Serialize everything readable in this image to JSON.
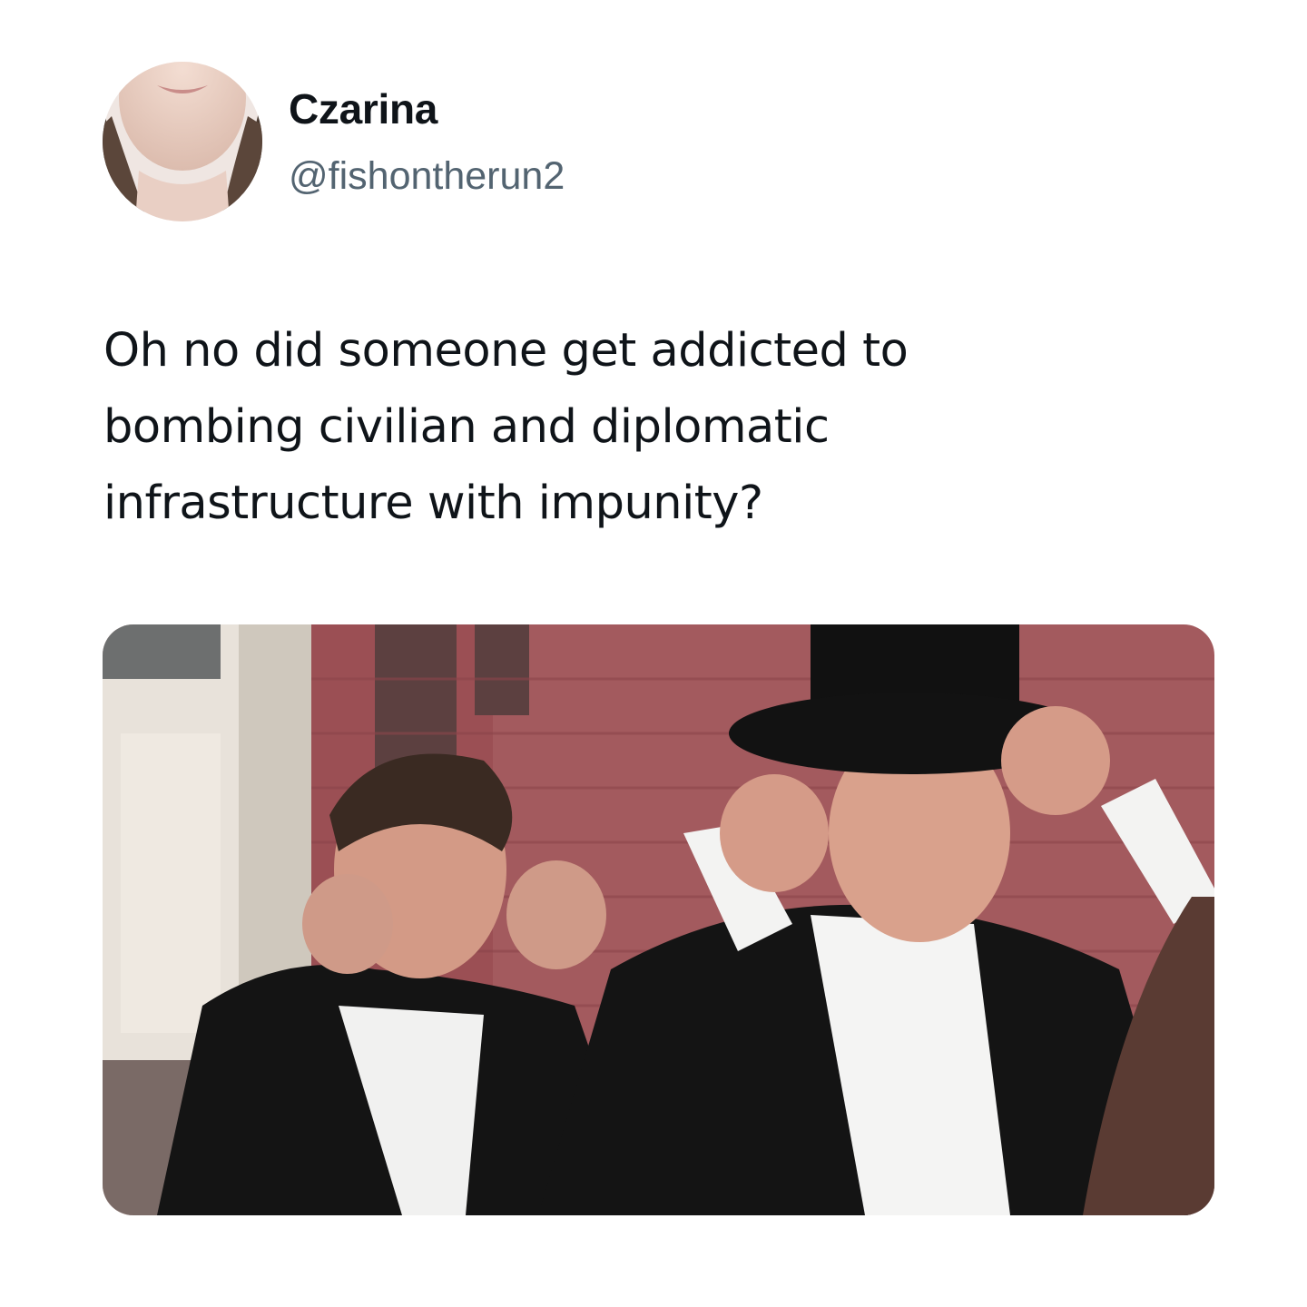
{
  "tweet": {
    "author": {
      "display_name": "Czarina",
      "handle": "@fishontherun2",
      "avatar_icon": "avatar-photo"
    },
    "text_lines": [
      "Oh no did someone get addicted to",
      "bombing civilian and diplomatic",
      "infrastructure with impunity?"
    ],
    "media": {
      "icon": "meme-photo"
    }
  },
  "colors": {
    "name": "#0f1419",
    "handle": "#536471",
    "background": "#ffffff"
  }
}
